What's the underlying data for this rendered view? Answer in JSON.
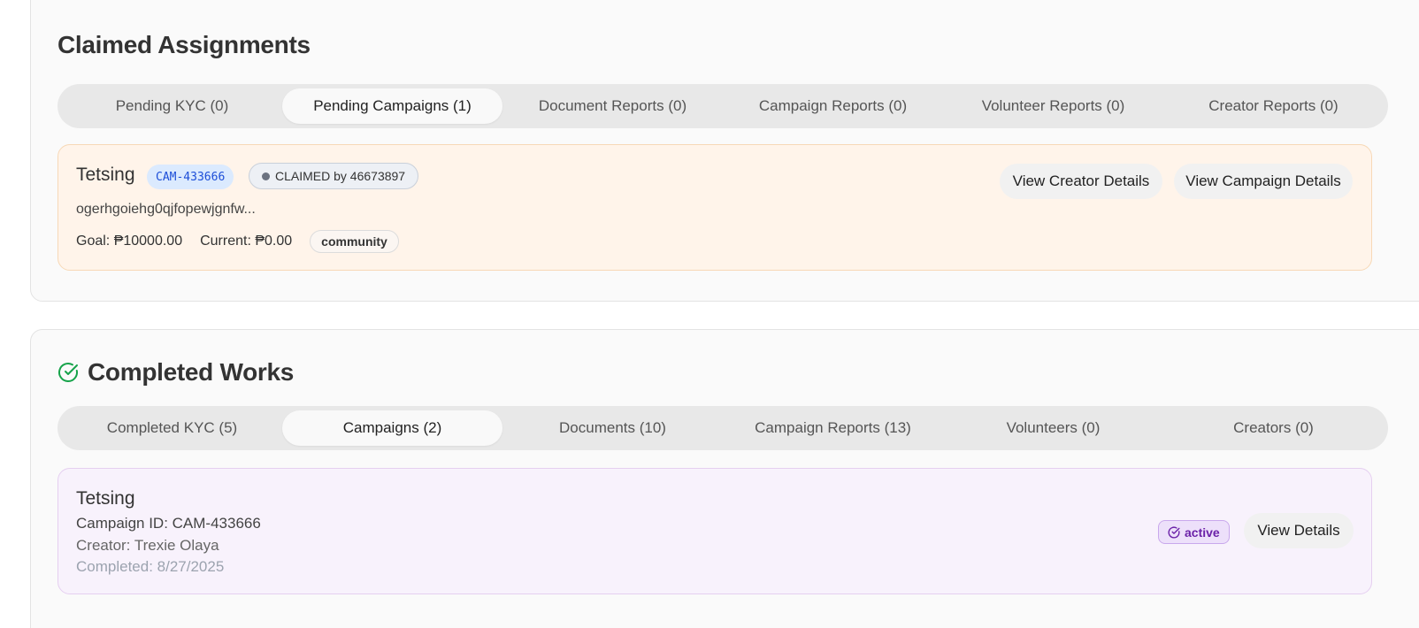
{
  "claimed": {
    "title": "Claimed Assignments",
    "tabs": [
      "Pending KYC (0)",
      "Pending Campaigns (1)",
      "Document Reports (0)",
      "Campaign Reports (0)",
      "Volunteer Reports (0)",
      "Creator Reports (0)"
    ],
    "active_tab": "Pending Campaigns (1)",
    "item": {
      "title": "Tetsing",
      "id": "CAM-433666",
      "claimed": "CLAIMED by 46673897",
      "description": "ogerhgoiehg0qjfopewjgnfw...",
      "goal": "Goal: ₱10000.00",
      "current": "Current: ₱0.00",
      "category": "community",
      "btn_creator": "View Creator Details",
      "btn_campaign": "View Campaign Details"
    }
  },
  "completed": {
    "title": "Completed Works",
    "icon": "check-circle-icon",
    "tabs": [
      "Completed KYC (5)",
      "Campaigns (2)",
      "Documents (10)",
      "Campaign Reports (13)",
      "Volunteers (0)",
      "Creators (0)"
    ],
    "active_tab": "Campaigns (2)",
    "item": {
      "title": "Tetsing",
      "campaign_id": "Campaign ID: CAM-433666",
      "creator": "Creator: Trexie Olaya",
      "completed": "Completed: 8/27/2025",
      "status": "active",
      "btn_details": "View Details"
    }
  },
  "colors": {
    "accent_green": "#16a34a",
    "claimed_bg": "#fff4ea",
    "completed_bg": "#f8f2fc",
    "id_chip": "#dbeafe",
    "status_purple": "#6b21a8"
  }
}
